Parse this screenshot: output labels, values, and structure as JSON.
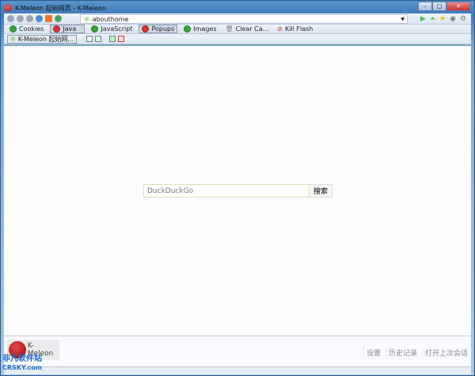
{
  "window": {
    "title": "K-Meleon 起始网页 - K-Meleon"
  },
  "address": {
    "url": "abouthome"
  },
  "toggles": [
    {
      "label": "Cookies",
      "state": "on"
    },
    {
      "label": "Java",
      "state": "off"
    },
    {
      "label": "JavaScript",
      "state": "on"
    },
    {
      "label": "Popups",
      "state": "off"
    },
    {
      "label": "Images",
      "state": "on"
    },
    {
      "label": "Clear Ca...",
      "state": "action"
    },
    {
      "label": "Kill Flash",
      "state": "action"
    }
  ],
  "tabs": [
    {
      "label": "K-Meleon 起始网..."
    }
  ],
  "search": {
    "placeholder": "DuckDuckGo",
    "button": "搜索"
  },
  "footer": {
    "logo": "K-Meleon",
    "links": [
      "设置",
      "历史记录",
      "打开上次会话"
    ]
  },
  "watermark": {
    "line1": "非凡软件站",
    "line2": "CRSKY.com"
  }
}
